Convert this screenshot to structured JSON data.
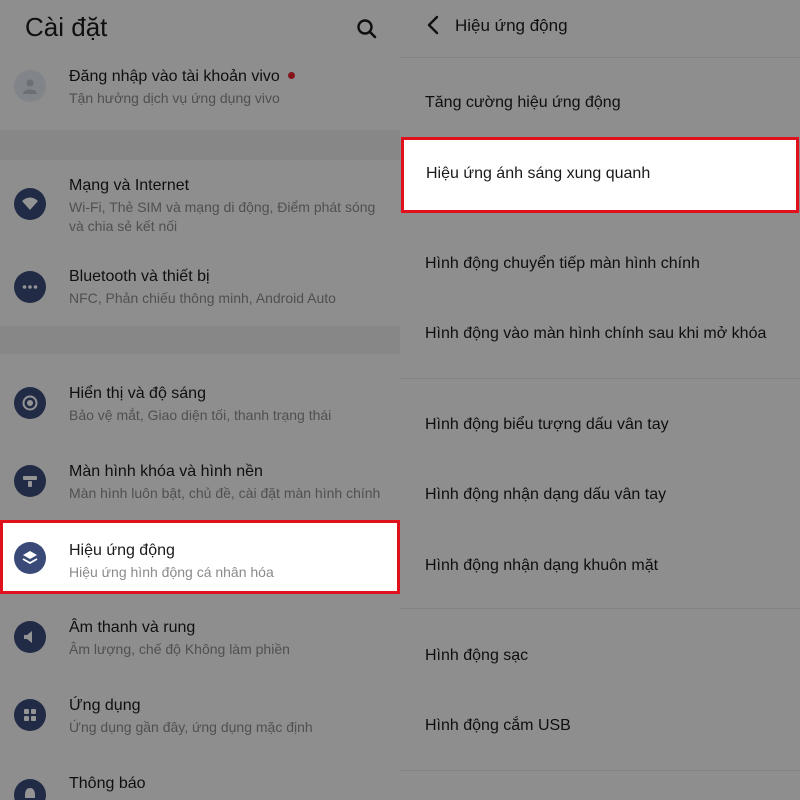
{
  "left": {
    "title": "Cài đặt",
    "account": {
      "title": "Đăng nhập vào tài khoản vivo",
      "subtitle": "Tận hưởng dịch vụ ứng dụng vivo"
    },
    "items": [
      {
        "title": "Mạng và Internet",
        "subtitle": "Wi-Fi, Thẻ SIM và mạng di động, Điểm phát sóng và chia sẻ kết nối"
      },
      {
        "title": "Bluetooth và thiết bị",
        "subtitle": "NFC, Phản chiếu thông minh, Android Auto"
      },
      {
        "title": "Hiển thị và độ sáng",
        "subtitle": "Bảo vệ mắt, Giao diện tối, thanh trạng thái"
      },
      {
        "title": "Màn hình khóa và hình nền",
        "subtitle": "Màn hình luôn bật, chủ đề, cài đặt màn hình chính"
      },
      {
        "title": "Hiệu ứng động",
        "subtitle": "Hiệu ứng hình động cá nhân hóa"
      },
      {
        "title": "Âm thanh và rung",
        "subtitle": "Âm lượng, chế độ Không làm phiền"
      },
      {
        "title": "Ứng dụng",
        "subtitle": "Ứng dụng gần đây, ứng dụng mặc định"
      },
      {
        "title": "Thông báo",
        "subtitle": ""
      }
    ]
  },
  "right": {
    "title": "Hiệu ứng động",
    "items": [
      "Tăng cường hiệu ứng động",
      "Hiệu ứng ánh sáng xung quanh",
      "Hình động chuyển tiếp màn hình chính",
      "Hình động vào màn hình chính sau khi mở khóa",
      "Hình động biểu tượng dấu vân tay",
      "Hình động nhận dạng dấu vân tay",
      "Hình động nhận dạng khuôn mặt",
      "Hình động sạc",
      "Hình động cắm USB"
    ]
  },
  "colors": {
    "highlight": "#e0101d",
    "icon": "#3a4a78",
    "notification_dot": "#e0242b"
  },
  "icons": [
    "search-icon",
    "back-arrow-icon",
    "avatar-icon",
    "wifi-icon",
    "more-dots-icon",
    "display-icon",
    "lock-screen-icon",
    "layers-icon",
    "speaker-icon",
    "apps-grid-icon",
    "bell-icon"
  ]
}
